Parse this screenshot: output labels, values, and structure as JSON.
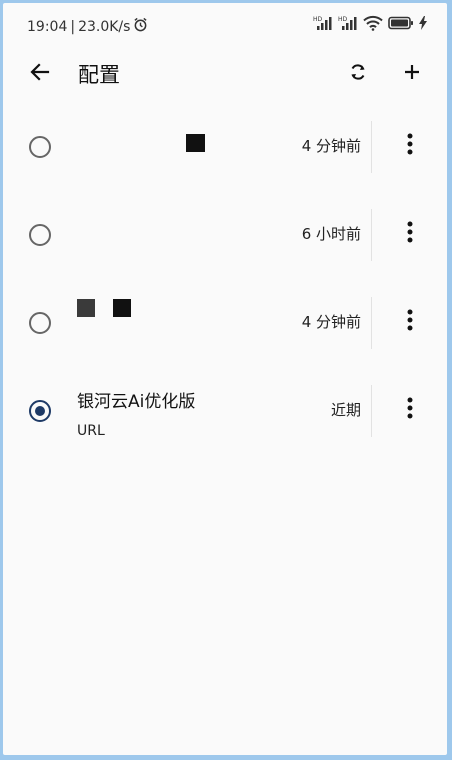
{
  "status_bar": {
    "time": "19:04",
    "network_speed": "23.0K/s",
    "icons": [
      "alarm-icon",
      "hd-signal-icon",
      "hd-signal-icon",
      "wifi-icon",
      "battery-icon",
      "charging-icon"
    ]
  },
  "app_bar": {
    "title": "配置",
    "icons": [
      "back-arrow-icon",
      "refresh-icon",
      "add-icon"
    ]
  },
  "profiles": [
    {
      "name": "",
      "subtitle": "",
      "time": "4 分钟前",
      "selected": false
    },
    {
      "name": "",
      "subtitle": "",
      "time": "6 小时前",
      "selected": false
    },
    {
      "name": "",
      "subtitle": "",
      "time": "4 分钟前",
      "selected": false
    },
    {
      "name": "银河云Ai优化版",
      "subtitle": "URL",
      "time": "近期",
      "selected": true
    }
  ],
  "colors": {
    "accent": "#1e3a66",
    "background": "#fafafa",
    "frame": "#9ec8ec"
  }
}
